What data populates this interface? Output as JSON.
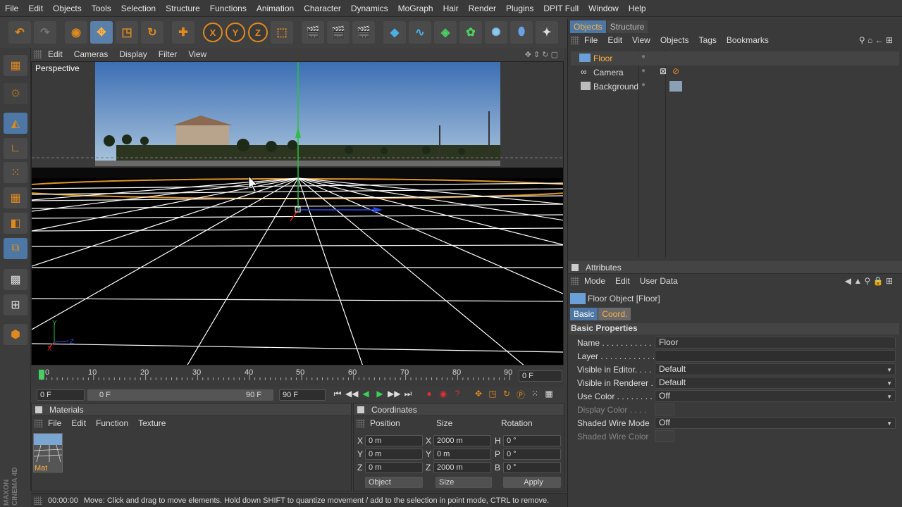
{
  "menu": [
    "File",
    "Edit",
    "Objects",
    "Tools",
    "Selection",
    "Structure",
    "Functions",
    "Animation",
    "Character",
    "Dynamics",
    "MoGraph",
    "Hair",
    "Render",
    "Plugins",
    "DPIT Full",
    "Window",
    "Help"
  ],
  "toolbar": {
    "undo": "undo-icon",
    "redo": "redo-icon",
    "live_select": "live-select-icon",
    "move": "move-icon",
    "scale": "scale-icon",
    "rotate": "rotate-icon",
    "add": "plus-icon",
    "x": "X",
    "y": "Y",
    "z": "Z"
  },
  "viewport": {
    "menu": [
      "Edit",
      "Cameras",
      "Display",
      "Filter",
      "View"
    ],
    "label": "Perspective"
  },
  "timeline": {
    "ticks": [
      "0",
      "10",
      "20",
      "30",
      "40",
      "50",
      "60",
      "70",
      "80",
      "90"
    ],
    "current_frame": "0 F",
    "start": "0 F",
    "range_start": "0 F",
    "range_end": "90 F",
    "end": "90 F"
  },
  "materials": {
    "title": "Materials",
    "menu": [
      "File",
      "Edit",
      "Function",
      "Texture"
    ],
    "items": [
      {
        "name": "Mat"
      }
    ]
  },
  "coordinates": {
    "title": "Coordinates",
    "headers": [
      "Position",
      "Size",
      "Rotation"
    ],
    "rows": [
      {
        "axis": "X",
        "pos": "0 m",
        "size_axis": "X",
        "size": "2000 m",
        "rot_axis": "H",
        "rot": "0 °"
      },
      {
        "axis": "Y",
        "pos": "0 m",
        "size_axis": "Y",
        "size": "0 m",
        "rot_axis": "P",
        "rot": "0 °"
      },
      {
        "axis": "Z",
        "pos": "0 m",
        "size_axis": "Z",
        "size": "2000 m",
        "rot_axis": "B",
        "rot": "0 °"
      }
    ],
    "mode": "Object",
    "size_mode": "Size",
    "apply": "Apply"
  },
  "status": {
    "time": "00:00:00",
    "message": "Move: Click and drag to move elements. Hold down SHIFT to quantize movement / add to the selection in point mode, CTRL to remove."
  },
  "objects_panel": {
    "tabs": [
      "Objects",
      "Structure"
    ],
    "menu": [
      "File",
      "Edit",
      "View",
      "Objects",
      "Tags",
      "Bookmarks"
    ],
    "items": [
      {
        "name": "Floor",
        "selected": true
      },
      {
        "name": "Camera",
        "selected": false
      },
      {
        "name": "Background",
        "selected": false
      }
    ]
  },
  "attributes": {
    "title": "Attributes",
    "menu": [
      "Mode",
      "Edit",
      "User Data"
    ],
    "object_title": "Floor Object [Floor]",
    "tabs": [
      "Basic",
      "Coord."
    ],
    "section": "Basic Properties",
    "rows": [
      {
        "label": "Name . . . . . . . . . . . .",
        "value": "Floor"
      },
      {
        "label": "Layer . . . . . . . . . . . .",
        "value": ""
      },
      {
        "label": "Visible in Editor. . . .",
        "value": "Default"
      },
      {
        "label": "Visible in Renderer .",
        "value": "Default"
      },
      {
        "label": "Use Color . . . . . . . .",
        "value": "Off"
      },
      {
        "label": "Display Color . . . .",
        "value": ""
      },
      {
        "label": "Shaded Wire Mode",
        "value": "Off"
      },
      {
        "label": "Shaded Wire Color",
        "value": ""
      }
    ]
  },
  "logo": "MAXON CINEMA 4D"
}
